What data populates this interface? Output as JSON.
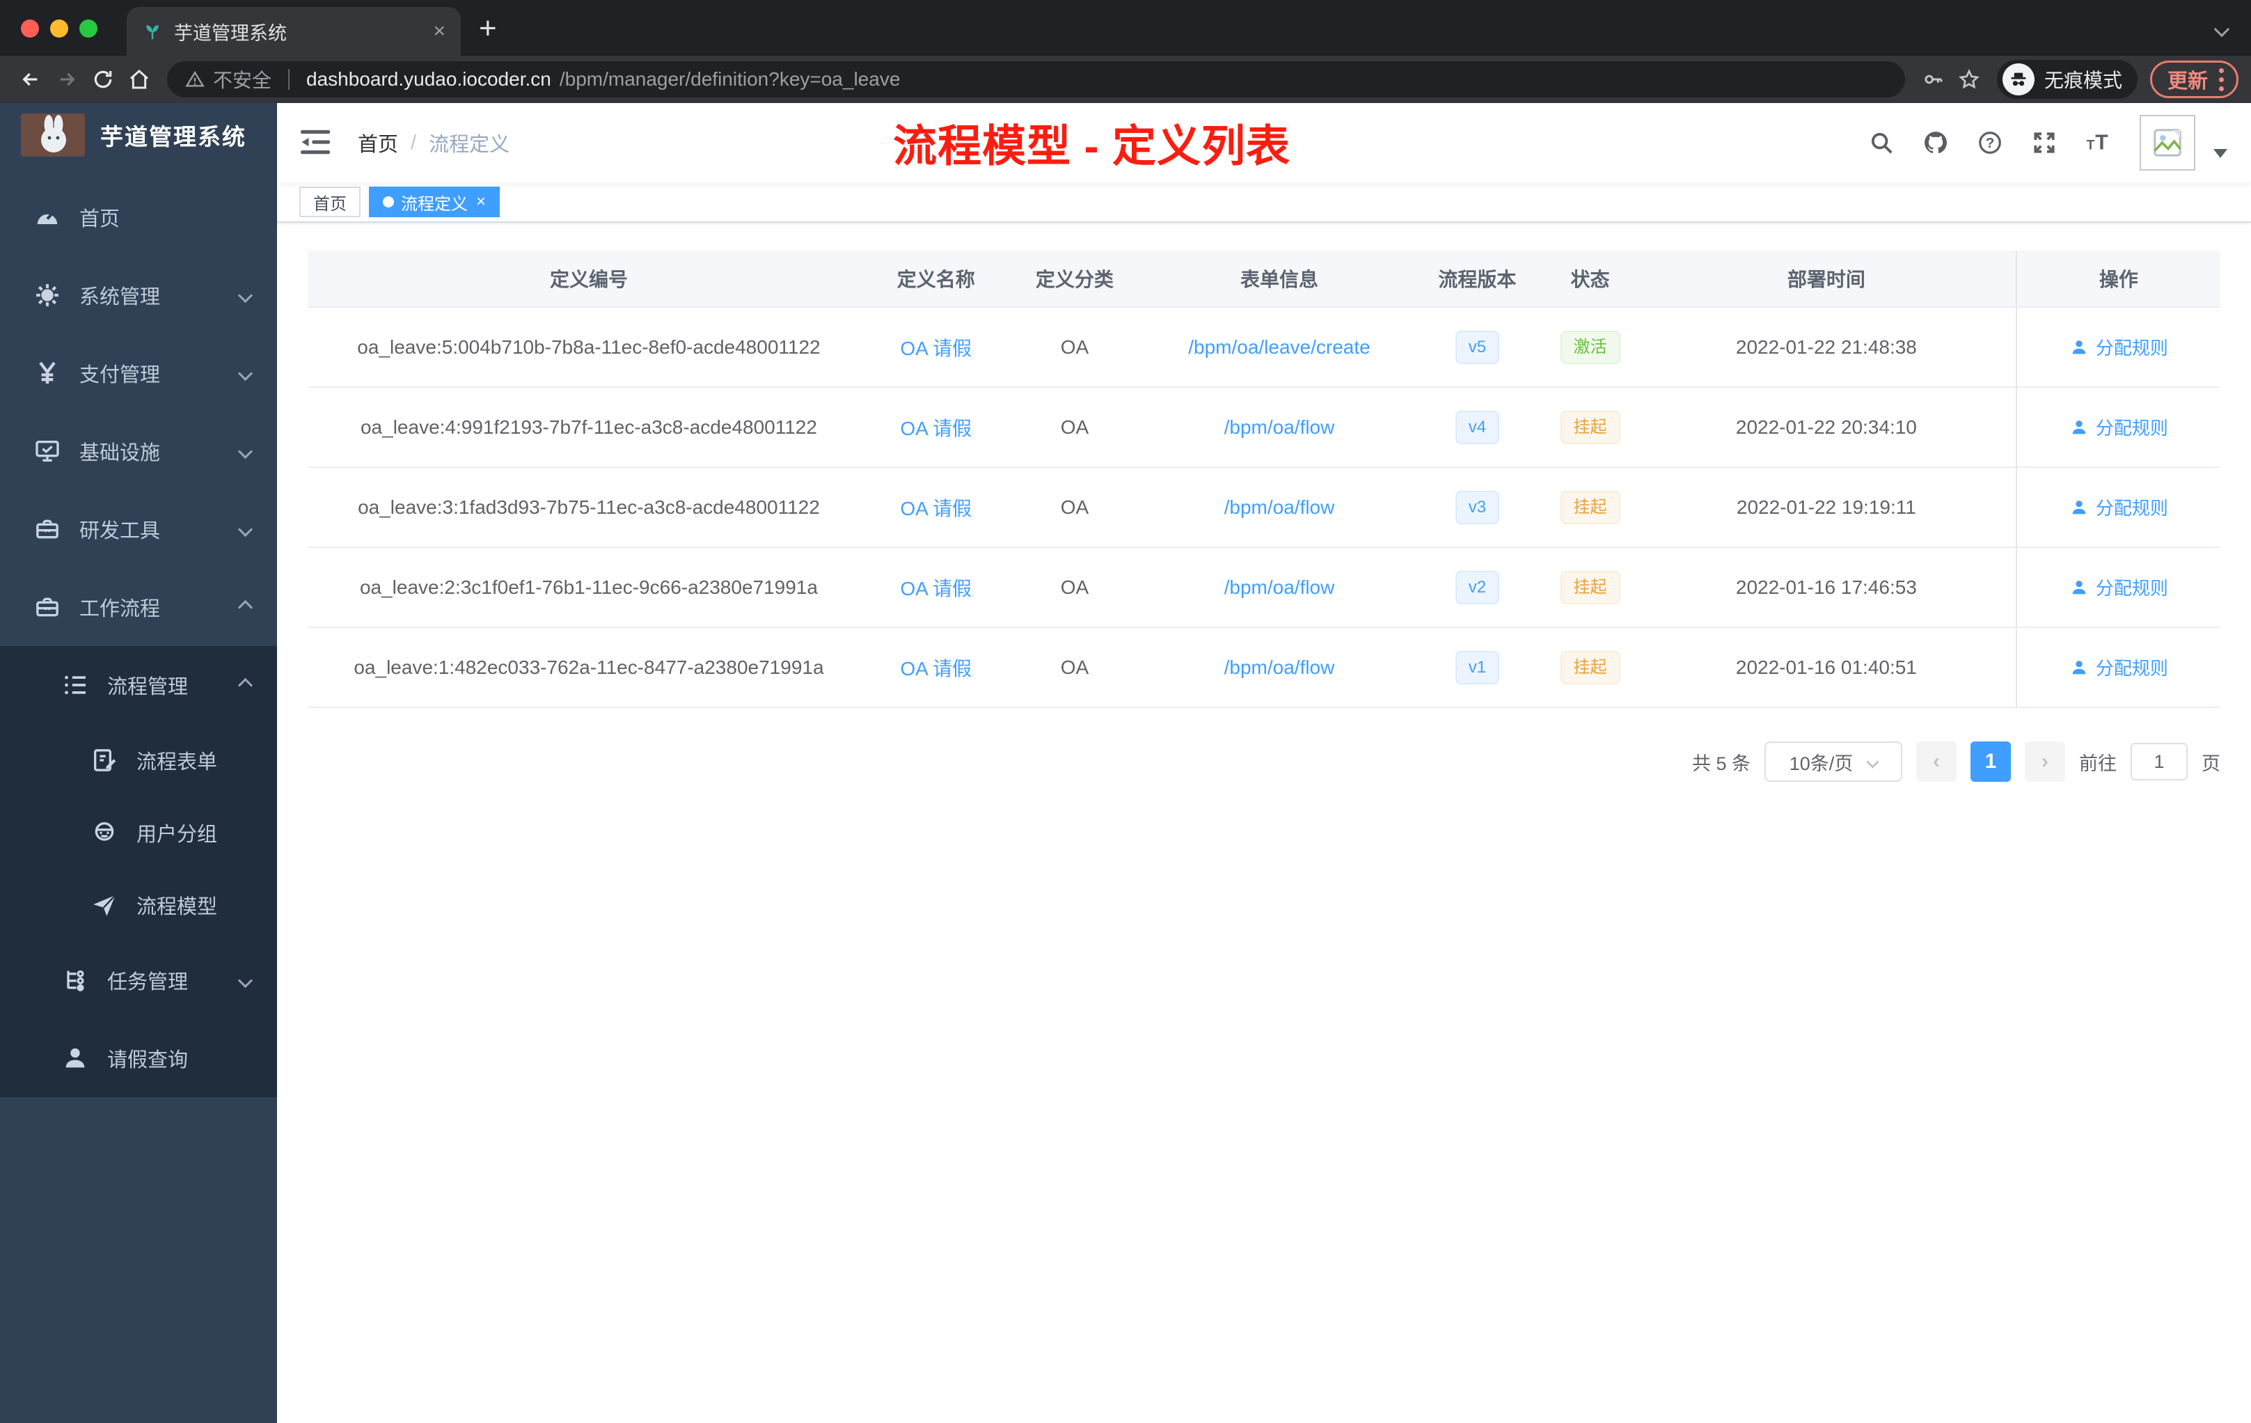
{
  "colors": {
    "accent": "#409eff",
    "sidebar_bg": "#304156",
    "submenu_bg": "#1f2d3d",
    "sidebar_text": "#bfcbd9",
    "success": "#67c23a",
    "warning": "#e6a23c",
    "annotation_red": "#fc1d10",
    "chrome_dark": "#202124",
    "chrome_toolbar": "#35363a",
    "update_red": "#f08b81"
  },
  "glyphs": {
    "close": "×",
    "plus": "+",
    "prev": "‹",
    "next": "›",
    "slash": "/"
  },
  "browser": {
    "tab_title": "芋道管理系统",
    "address": {
      "warning_label": "不安全",
      "host": "dashboard.yudao.iocoder.cn",
      "path": "/bpm/manager/definition?key=oa_leave"
    },
    "incognito_label": "无痕模式",
    "update_label": "更新"
  },
  "sidebar": {
    "logo_title": "芋道管理系统",
    "menu": [
      {
        "label": "首页",
        "icon": "dashboard-icon"
      },
      {
        "label": "系统管理",
        "icon": "gear-icon"
      },
      {
        "label": "支付管理",
        "icon": "yen-icon"
      },
      {
        "label": "基础设施",
        "icon": "monitor-icon"
      },
      {
        "label": "研发工具",
        "icon": "toolbox-icon"
      },
      {
        "label": "工作流程",
        "icon": "briefcase-icon"
      }
    ],
    "submenu": {
      "parent": {
        "label": "流程管理",
        "icon": "list-icon"
      },
      "children": [
        {
          "label": "流程表单",
          "icon": "form-icon"
        },
        {
          "label": "用户分组",
          "icon": "users-icon"
        },
        {
          "label": "流程模型",
          "icon": "send-icon"
        }
      ],
      "siblings": [
        {
          "label": "任务管理",
          "icon": "tree-icon"
        },
        {
          "label": "请假查询",
          "icon": "user-icon"
        }
      ]
    }
  },
  "header": {
    "breadcrumb": [
      "首页",
      "流程定义"
    ],
    "annotation": "流程模型 - 定义列表"
  },
  "tags": [
    {
      "label": "首页"
    },
    {
      "label": "流程定义"
    }
  ],
  "table": {
    "columns": [
      "定义编号",
      "定义名称",
      "定义分类",
      "表单信息",
      "流程版本",
      "状态",
      "部署时间",
      "操作"
    ],
    "rows": [
      {
        "id": "oa_leave:5:004b710b-7b8a-11ec-8ef0-acde48001122",
        "name": "OA 请假",
        "category": "OA",
        "form": "/bpm/oa/leave/create",
        "version": "v5",
        "status": "激活",
        "time": "2022-01-22 21:48:38",
        "action": "分配规则"
      },
      {
        "id": "oa_leave:4:991f2193-7b7f-11ec-a3c8-acde48001122",
        "name": "OA 请假",
        "category": "OA",
        "form": "/bpm/oa/flow",
        "version": "v4",
        "status": "挂起",
        "time": "2022-01-22 20:34:10",
        "action": "分配规则"
      },
      {
        "id": "oa_leave:3:1fad3d93-7b75-11ec-a3c8-acde48001122",
        "name": "OA 请假",
        "category": "OA",
        "form": "/bpm/oa/flow",
        "version": "v3",
        "status": "挂起",
        "time": "2022-01-22 19:19:11",
        "action": "分配规则"
      },
      {
        "id": "oa_leave:2:3c1f0ef1-76b1-11ec-9c66-a2380e71991a",
        "name": "OA 请假",
        "category": "OA",
        "form": "/bpm/oa/flow",
        "version": "v2",
        "status": "挂起",
        "time": "2022-01-16 17:46:53",
        "action": "分配规则"
      },
      {
        "id": "oa_leave:1:482ec033-762a-11ec-8477-a2380e71991a",
        "name": "OA 请假",
        "category": "OA",
        "form": "/bpm/oa/flow",
        "version": "v1",
        "status": "挂起",
        "time": "2022-01-16 01:40:51",
        "action": "分配规则"
      }
    ]
  },
  "pagination": {
    "total": "共 5 条",
    "page_size": "10条/页",
    "page": "1",
    "goto_label": "前往",
    "goto_value": "1",
    "page_unit": "页"
  }
}
